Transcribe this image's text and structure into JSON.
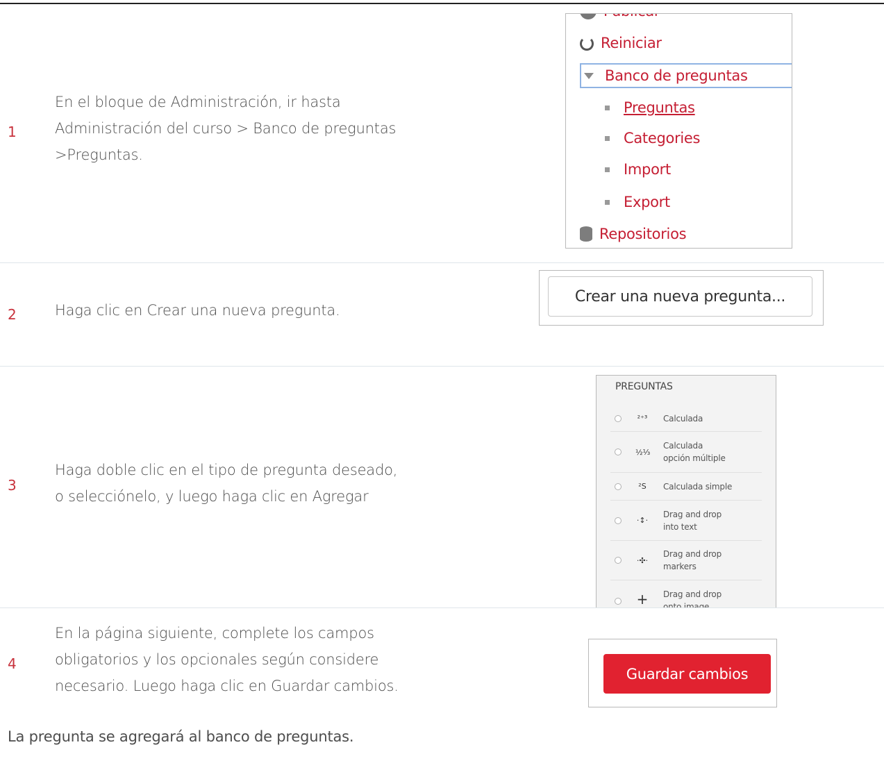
{
  "steps": [
    {
      "number": "1",
      "text_lines": [
        "En el bloque de Administración, ir hasta",
        "Administración del curso > Banco de preguntas",
        ">Preguntas."
      ]
    },
    {
      "number": "2",
      "text_lines": [
        "Haga clic en Crear una nueva pregunta."
      ]
    },
    {
      "number": "3",
      "text_lines": [
        "Haga doble clic en el tipo de pregunta deseado,",
        "o selecciónelo, y luego haga clic en Agregar"
      ]
    },
    {
      "number": "4",
      "text_lines": [
        "En la página siguiente, complete los campos",
        "obligatorios y los opcionales según considere",
        "necesario. Luego haga clic en Guardar cambios."
      ]
    }
  ],
  "footer_text": "La pregunta se agregará al banco de preguntas.",
  "admin_menu": {
    "items": [
      {
        "label": "Publicar",
        "icon": "globe-icon"
      },
      {
        "label": "Reiniciar",
        "icon": "reload-icon"
      },
      {
        "label": "Banco de preguntas",
        "icon": "triangle-down-icon"
      },
      {
        "label": "Preguntas",
        "icon": "bullet-icon"
      },
      {
        "label": "Categories",
        "icon": "bullet-icon"
      },
      {
        "label": "Import",
        "icon": "bullet-icon"
      },
      {
        "label": "Export",
        "icon": "bullet-icon"
      },
      {
        "label": "Repositorios",
        "icon": "database-icon"
      }
    ]
  },
  "create_button_label": "Crear una nueva pregunta...",
  "question_types": {
    "header": "PREGUNTAS",
    "items": [
      {
        "label_1": "Calculada",
        "label_2": "",
        "icon": "calculated-icon",
        "glyph": "²⁺³"
      },
      {
        "label_1": "Calculada",
        "label_2": "opción múltiple",
        "icon": "calculated-multichoice-icon",
        "glyph": "½⅓"
      },
      {
        "label_1": "Calculada simple",
        "label_2": "",
        "icon": "calculated-simple-icon",
        "glyph": "²S"
      },
      {
        "label_1": "Drag and drop",
        "label_2": "into text",
        "icon": "drag-drop-text-icon",
        "glyph": "·↕·"
      },
      {
        "label_1": "Drag and drop",
        "label_2": "markers",
        "icon": "drag-drop-markers-icon",
        "glyph": "·✣·"
      },
      {
        "label_1": "Drag and drop",
        "label_2": "onto image",
        "icon": "drag-drop-image-icon",
        "glyph": "+"
      }
    ]
  },
  "save_button_label": "Guardar cambios",
  "colors": {
    "step_number": "#c8323c",
    "menu_link": "#c51e33",
    "save_button": "#e12230"
  }
}
